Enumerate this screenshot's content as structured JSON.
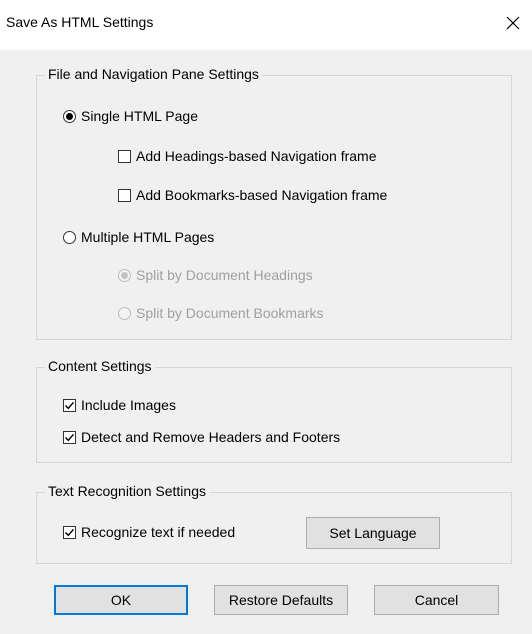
{
  "dialog": {
    "title": "Save As HTML Settings",
    "close_glyph": "×"
  },
  "file_nav": {
    "legend": "File and Navigation Pane Settings",
    "single_page": {
      "label": "Single HTML Page",
      "selected": true
    },
    "headings_nav": {
      "label": "Add Headings-based Navigation frame",
      "checked": false
    },
    "bookmarks_nav": {
      "label": "Add Bookmarks-based Navigation frame",
      "checked": false
    },
    "multiple_pages": {
      "label": "Multiple HTML Pages",
      "selected": false
    },
    "split_headings": {
      "label": "Split by Document Headings",
      "selected": true,
      "disabled": true
    },
    "split_bookmarks": {
      "label": "Split by Document Bookmarks",
      "selected": false,
      "disabled": true
    }
  },
  "content": {
    "legend": "Content Settings",
    "include_images": {
      "label": "Include Images",
      "checked": true
    },
    "remove_headers": {
      "label": "Detect and Remove Headers and Footers",
      "checked": true
    }
  },
  "text_recognition": {
    "legend": "Text Recognition Settings",
    "recognize": {
      "label": "Recognize text if needed",
      "checked": true
    },
    "set_language_label": "Set Language"
  },
  "buttons": {
    "ok_label": "OK",
    "restore_label": "Restore Defaults",
    "cancel_label": "Cancel"
  }
}
